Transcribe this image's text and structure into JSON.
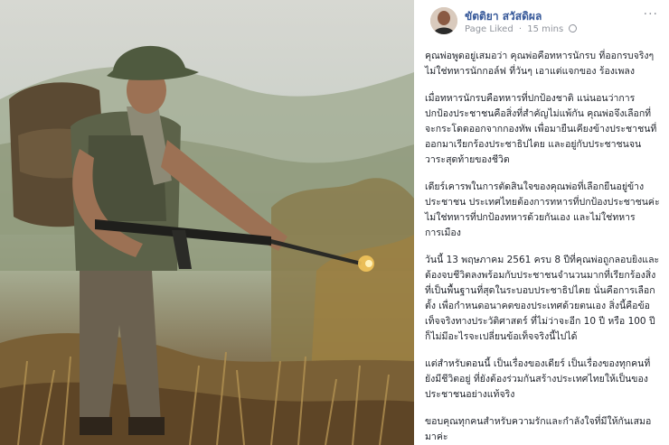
{
  "post": {
    "page_name": "ขัตติยา สวัสดิผล",
    "status": "Page Liked",
    "separator": "·",
    "time": "15 mins",
    "more_label": "···",
    "icons": {
      "globe": "globe-icon",
      "more": "more-options-icon"
    },
    "paragraphs": [
      "คุณพ่อพูดอยู่เสมอว่า คุณพ่อคือทหารนักรบ ที่ออกรบจริงๆ ไม่ใช่ทหารนักกอล์ฟ ที่วันๆ เอาแต่แจกของ ร้องเพลง",
      "เมื่อทหารนักรบคือทหารที่ปกป้องชาติ แน่นอนว่าการปกป้องประชาชนคือสิ่งที่สำคัญไม่แพ้กัน คุณพ่อจึงเลือกที่จะกระโดดออกจากกองทัพ เพื่อมายืนเคียงข้างประชาชนที่ออกมาเรียกร้องประชาธิปไตย และอยู่กับประชาชนจนวาระสุดท้ายของชีวิต",
      "เดียร์เคารพในการตัดสินใจของคุณพ่อที่เลือกยืนอยู่ข้างประชาชน ประเทศไทยต้องการทหารที่ปกป้องประชาชนค่ะ ไม่ใช่ทหารที่ปกป้องทหารด้วยกันเอง และไม่ใช่ทหารการเมือง",
      "วันนี้ 13 พฤษภาคม 2561 ครบ 8 ปีที่คุณพ่อถูกลอบยิงและต้องจบชีวิตลงพร้อมกับประชาชนจำนวนมากที่เรียกร้องสิ่งที่เป็นพื้นฐานที่สุดในระบอบประชาธิปไตย นั่นคือการเลือกตั้ง เพื่อกำหนดอนาคตของประเทศด้วยตนเอง สิ่งนี้คือข้อเท็จจริงทางประวัติศาสตร์ ที่ไม่ว่าจะอีก 10 ปี หรือ 100 ปี ก็ไม่มีอะไรจะเปลี่ยนข้อเท็จจริงนี้ไปได้",
      "แต่สำหรับตอนนี้ เป็นเรื่องของเดียร์ เป็นเรื่องของทุกคนที่ยังมีชีวิตอยู่ ที่ยังต้องร่วมกันสร้างประเทศไทยให้เป็นของประชาชนอย่างแท้จริง",
      "ขอบคุณทุกคนสำหรับความรักและกำลังใจที่มีให้กันเสมอมาค่ะ"
    ]
  },
  "colors": {
    "link": "#365899",
    "meta": "#90949c",
    "text": "#1d2129"
  }
}
